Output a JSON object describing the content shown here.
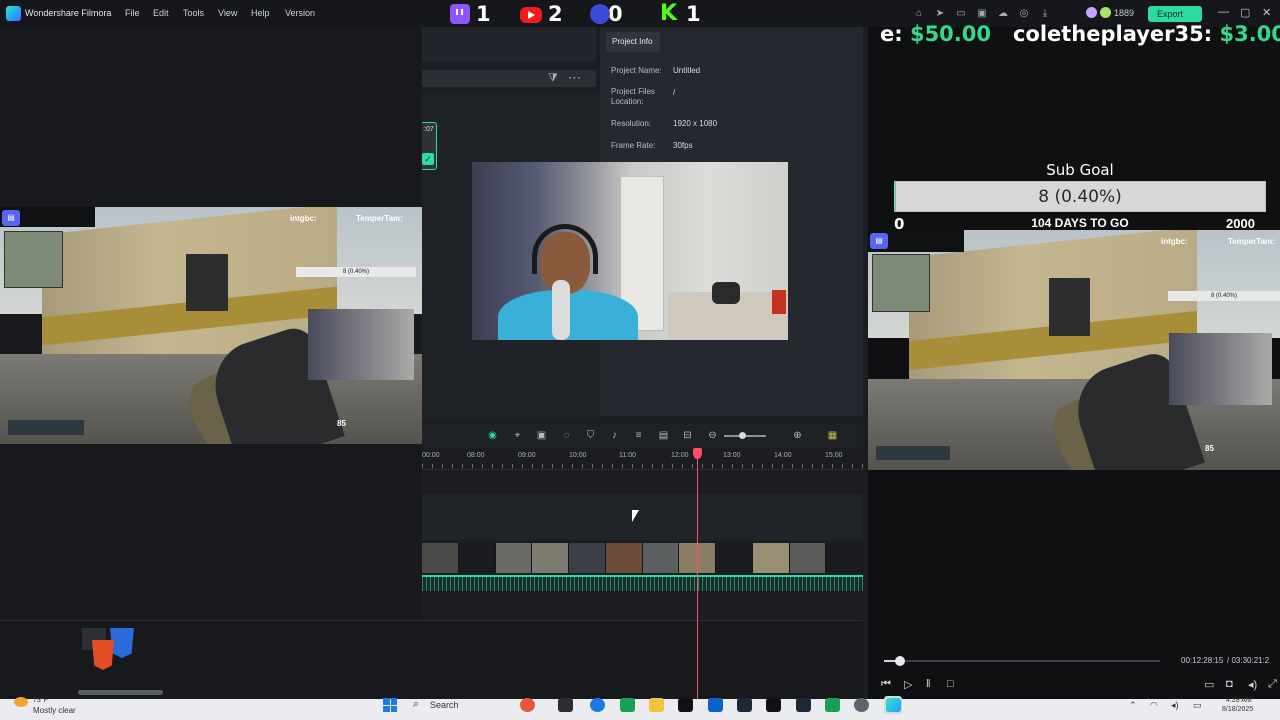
{
  "menubar": {
    "app_name": "Wondershare Filmora",
    "menu": [
      "File",
      "Edit",
      "Tools",
      "View",
      "Help",
      "Version"
    ],
    "coins": "1889",
    "export_label": "Export"
  },
  "stream_counters": {
    "twitch": "1",
    "youtube": "2",
    "kick_logo_count": "0",
    "kick": "1"
  },
  "media": {
    "thumb_time": ":07"
  },
  "project_info": {
    "tab": "Project Info",
    "fields": [
      {
        "label": "Project Name:",
        "value": "Untitled"
      },
      {
        "label": "Project Files Location:",
        "value": "/"
      },
      {
        "label": "Resolution:",
        "value": "1920 x 1080"
      },
      {
        "label": "Frame Rate:",
        "value": "30fps"
      }
    ]
  },
  "timeline": {
    "ruler": [
      "00:00",
      "08:00",
      "09:00",
      "10:00",
      "11:00",
      "12:00",
      "13:00",
      "14:00",
      "15:00"
    ],
    "playhead_fraction": 0.623
  },
  "gameplay": {
    "hud_left_name": "intgbc:",
    "hud_right_name": "TemperTam:",
    "sub_value": "8 (0.40%)",
    "ammo": "85"
  },
  "preview": {
    "donation_prefix": "e: ",
    "donation_amount": "$50.00",
    "donation2_name": "coletheplayer35: ",
    "donation2_amount": "$3.00",
    "sub_goal_title": "Sub Goal",
    "sub_goal_value": "8 (0.40%)",
    "sub_goal_fraction": 0.004,
    "sub_goal_min": "0",
    "sub_goal_days": "104 DAYS TO GO",
    "sub_goal_max": "2000",
    "current_time": "00:12:28:15",
    "total_time": "/ 03:30:21:2",
    "progress_fraction": 0.059
  },
  "taskbar": {
    "weather_temp": "73°F",
    "weather": "Mostly clear",
    "search": "Search",
    "time": "4:28 AM",
    "date": "8/18/2025"
  }
}
